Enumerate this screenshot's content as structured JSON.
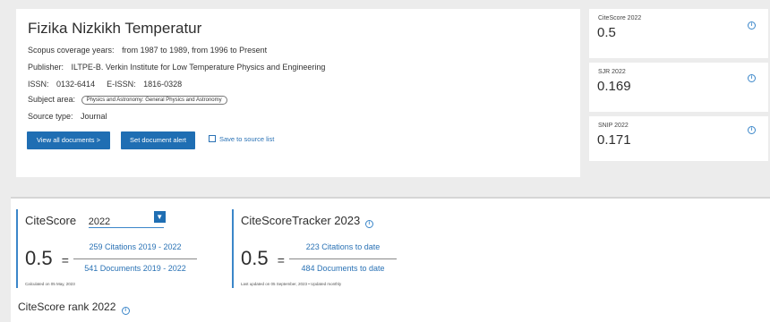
{
  "source": {
    "title": "Fizika Nizkikh Temperatur",
    "coverage_label": "Scopus coverage years:",
    "coverage_value": "from 1987 to 1989, from 1996 to Present",
    "publisher_label": "Publisher:",
    "publisher_value": "ILTPE-B. Verkin Institute for Low Temperature Physics and Engineering",
    "issn_label": "ISSN:",
    "issn_value": "0132-6414",
    "eissn_label": "E-ISSN:",
    "eissn_value": "1816-0328",
    "subject_label": "Subject area:",
    "subject_value": "Physics and Astronomy: General Physics and Astronomy",
    "type_label": "Source type:",
    "type_value": "Journal",
    "view_all_label": "View all documents >",
    "alert_label": "Set document alert",
    "save_label": "Save to source list"
  },
  "metrics": [
    {
      "label": "CiteScore 2022",
      "value": "0.5"
    },
    {
      "label": "SJR 2022",
      "value": "0.169"
    },
    {
      "label": "SNIP 2022",
      "value": "0.171"
    }
  ],
  "citescore": {
    "heading": "CiteScore",
    "year": "2022",
    "value": "0.5",
    "dash": "=",
    "numerator": "259 Citations 2019 - 2022",
    "denominator": "541 Documents 2019 - 2022",
    "note": "Calculated on 05 May, 2023"
  },
  "tracker": {
    "heading": "CiteScoreTracker 2023",
    "value": "0.5",
    "dash": "=",
    "numerator": "223 Citations to date",
    "denominator": "484 Documents to date",
    "note": "Last updated on 05 September, 2023 • Updated monthly"
  },
  "rank": {
    "heading": "CiteScore rank 2022"
  },
  "colors": {
    "accent": "#1f6eb3",
    "link": "#2a72b5"
  },
  "icons": {
    "info": "info-circle-icon",
    "bookmark": "bookmark-icon",
    "dropdown": "chevron-down-icon"
  }
}
